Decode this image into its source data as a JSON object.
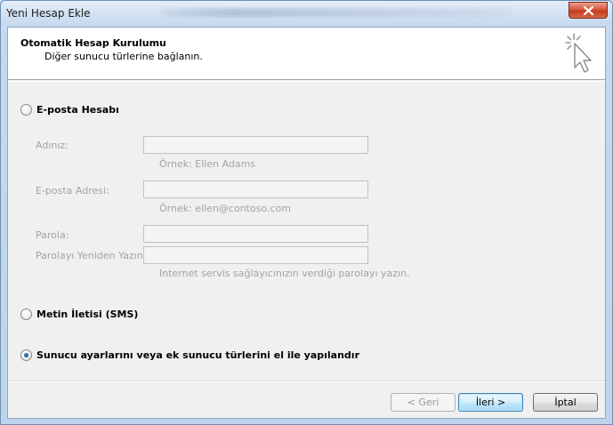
{
  "window": {
    "title": "Yeni Hesap Ekle"
  },
  "header": {
    "title": "Otomatik Hesap Kurulumu",
    "subtitle": "Diğer sunucu türlerine bağlanın."
  },
  "options": {
    "email_account": {
      "label": "E-posta Hesabı",
      "selected": false
    },
    "sms": {
      "label": "Metin İletisi (SMS)",
      "selected": false
    },
    "manual": {
      "label": "Sunucu ayarlarını veya ek sunucu türlerini el ile yapılandır",
      "selected": true
    }
  },
  "form": {
    "name_label": "Adınız:",
    "name_value": "",
    "name_hint": "Örnek: Ellen Adams",
    "email_label": "E-posta Adresi:",
    "email_value": "",
    "email_hint": "Örnek: ellen@contoso.com",
    "password_label": "Parola:",
    "password_value": "",
    "retype_label": "Parolayı Yeniden Yazın:",
    "retype_value": "",
    "password_hint": "Internet servis sağlayıcınızın verdiği parolayı yazın."
  },
  "buttons": {
    "back": "< Geri",
    "next": "İleri >",
    "cancel": "İptal"
  },
  "colors": {
    "accent": "#3c7fb1",
    "disabled_text": "#a3a3a3",
    "close": "#c53b1e"
  },
  "icons": {
    "close": "close-icon",
    "header": "cursor-sparkle-icon"
  }
}
